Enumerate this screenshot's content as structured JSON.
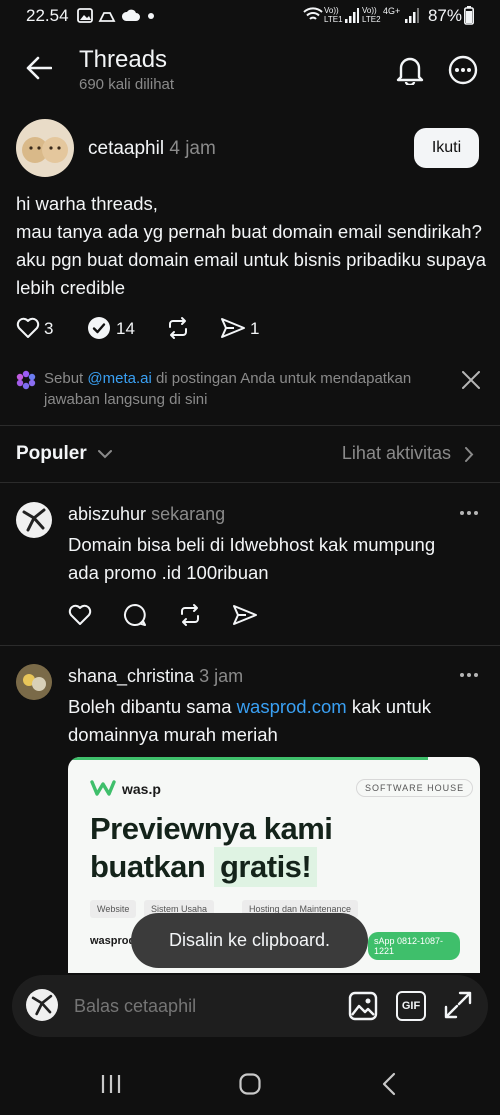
{
  "status_bar": {
    "time": "22.54",
    "battery": "87%",
    "sim1_label": "Vo)) LTE1",
    "sim2_label": "Vo)) LTE2",
    "network": "4G+"
  },
  "header": {
    "title": "Threads",
    "views": "690 kali dilihat"
  },
  "post": {
    "username": "cetaaphil",
    "time": "4 jam",
    "follow_label": "Ikuti",
    "text": "hi warha threads,\nmau tanya ada yg pernah buat domain email sendirikah? aku pgn buat domain email untuk bisnis pribadiku supaya lebih credible",
    "likes": "3",
    "reposts": "14",
    "shares": "1"
  },
  "meta_tip": {
    "prefix": "Sebut ",
    "mention": "@meta.ai",
    "suffix": " di postingan Anda untuk mendapatkan jawaban langsung di sini"
  },
  "replies_header": {
    "sort": "Populer",
    "activity": "Lihat aktivitas"
  },
  "replies": [
    {
      "username": "abiszuhur",
      "time": "sekarang",
      "text": "Domain bisa beli di Idwebhost kak mumpung ada promo .id 100ribuan"
    },
    {
      "username": "shana_christina",
      "time": "3 jam",
      "text_before": "Boleh dibantu sama ",
      "link": "wasprod.com",
      "text_after": " kak untuk domainnya murah meriah"
    }
  ],
  "preview": {
    "brand": "was.p",
    "badge": "SOFTWARE HOUSE",
    "headline_1": "Previewnya kami",
    "headline_2": "buatkan",
    "headline_highlight": "gratis!",
    "chips": [
      "Website",
      "Sistem Usaha",
      "Hosting dan Maintenance"
    ],
    "domain": "wasprod",
    "whatsapp": "sApp 0812-1087-1221"
  },
  "toast": "Disalin ke clipboard.",
  "reply_bar": {
    "placeholder": "Balas cetaaphil",
    "gif_label": "GIF"
  },
  "colors": {
    "background": "#101010",
    "link": "#3aa0f3",
    "muted": "#8a8a8a",
    "accent_green": "#3fbf6b"
  }
}
